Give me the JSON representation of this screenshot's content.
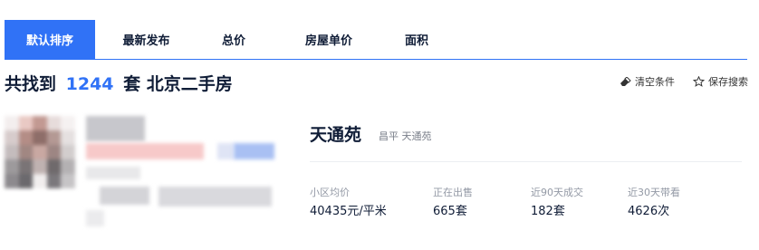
{
  "tabs": [
    {
      "label": "默认排序",
      "active": true
    },
    {
      "label": "最新发布",
      "active": false
    },
    {
      "label": "总价",
      "active": false
    },
    {
      "label": "房屋单价",
      "active": false
    },
    {
      "label": "面积",
      "active": false
    }
  ],
  "result": {
    "prefix": "共找到",
    "count": "1244",
    "suffix": "套 北京二手房"
  },
  "actions": {
    "clear_label": "清空条件",
    "clear_icon": "eraser-icon",
    "save_label": "保存搜索",
    "save_icon": "star-icon"
  },
  "listing": {
    "title": "天通苑",
    "district": "昌平 天通苑",
    "stats": [
      {
        "label": "小区均价",
        "value": "40435元/平米"
      },
      {
        "label": "正在出售",
        "value": "665套"
      },
      {
        "label": "近90天成交",
        "value": "182套"
      },
      {
        "label": "近30天带看",
        "value": "4626次"
      }
    ]
  },
  "colors": {
    "accent": "#3072f6",
    "text": "#101d37",
    "muted": "#9399a5"
  }
}
